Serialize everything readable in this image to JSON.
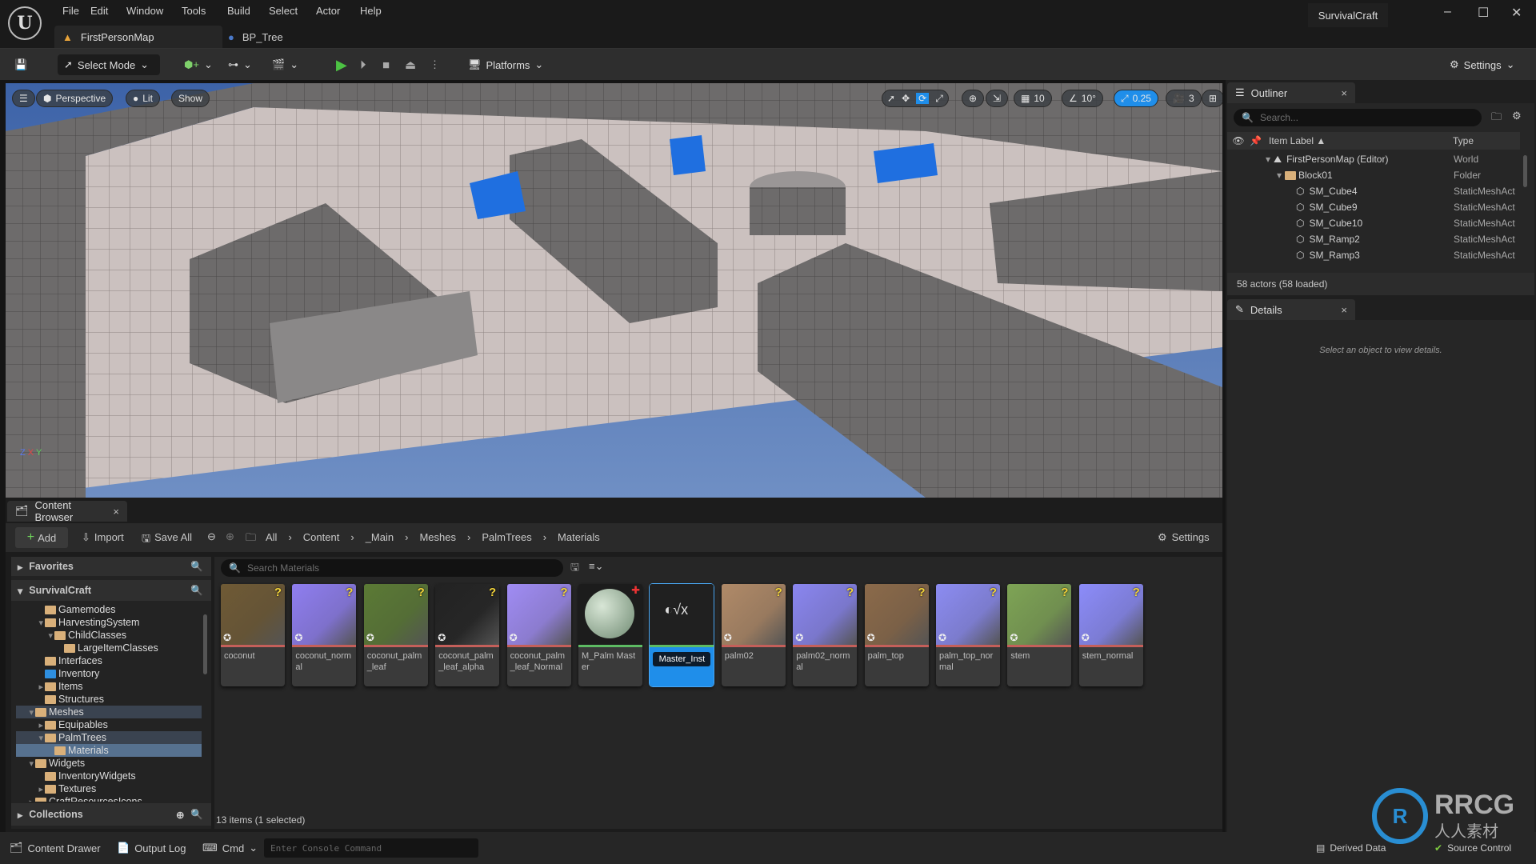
{
  "app": {
    "menu": [
      "File",
      "Edit",
      "Window",
      "Tools",
      "Build",
      "Select",
      "Actor",
      "Help"
    ],
    "tabs": [
      "FirstPersonMap",
      "BP_Tree"
    ],
    "project": "SurvivalCraft"
  },
  "toolbar": {
    "select_mode": "Select Mode",
    "platforms": "Platforms",
    "settings": "Settings"
  },
  "viewport": {
    "perspective": "Perspective",
    "lit": "Lit",
    "show": "Show",
    "grid_snap": "10",
    "rot_snap": "10°",
    "scale_snap": "0.25",
    "cam_speed": "3",
    "axis_labels": [
      "Z",
      "X",
      "Y"
    ]
  },
  "outliner": {
    "title": "Outliner",
    "search_placeholder": "Search...",
    "col_label": "Item Label",
    "col_type": "Type",
    "rows": [
      {
        "label": "FirstPersonMap (Editor)",
        "type": "World",
        "indent": 0,
        "icon": "world-icon"
      },
      {
        "label": "Block01",
        "type": "Folder",
        "indent": 1,
        "icon": "folder-icon"
      },
      {
        "label": "SM_Cube4",
        "type": "StaticMeshAct",
        "indent": 2,
        "icon": "static-mesh-icon"
      },
      {
        "label": "SM_Cube9",
        "type": "StaticMeshAct",
        "indent": 2,
        "icon": "static-mesh-icon"
      },
      {
        "label": "SM_Cube10",
        "type": "StaticMeshAct",
        "indent": 2,
        "icon": "static-mesh-icon"
      },
      {
        "label": "SM_Ramp2",
        "type": "StaticMeshAct",
        "indent": 2,
        "icon": "static-mesh-icon"
      },
      {
        "label": "SM_Ramp3",
        "type": "StaticMeshAct",
        "indent": 2,
        "icon": "static-mesh-icon"
      }
    ],
    "status": "58 actors (58 loaded)"
  },
  "details": {
    "title": "Details",
    "empty": "Select an object to view details."
  },
  "content_browser": {
    "title": "Content Browser",
    "add": "Add",
    "import": "Import",
    "save_all": "Save All",
    "settings": "Settings",
    "breadcrumb": [
      "All",
      "Content",
      "_Main",
      "Meshes",
      "PalmTrees",
      "Materials"
    ],
    "favorites": "Favorites",
    "project": "SurvivalCraft",
    "collections": "Collections",
    "search_placeholder": "Search Materials",
    "tree": [
      {
        "label": "Gamemodes",
        "indent": 2,
        "exp": ""
      },
      {
        "label": "HarvestingSystem",
        "indent": 2,
        "exp": "open"
      },
      {
        "label": "ChildClasses",
        "indent": 3,
        "exp": "open"
      },
      {
        "label": "LargeItemClasses",
        "indent": 4,
        "exp": ""
      },
      {
        "label": "Interfaces",
        "indent": 2,
        "exp": ""
      },
      {
        "label": "Inventory",
        "indent": 2,
        "exp": "",
        "blue": true
      },
      {
        "label": "Items",
        "indent": 2,
        "exp": "closed"
      },
      {
        "label": "Structures",
        "indent": 2,
        "exp": ""
      },
      {
        "label": "Meshes",
        "indent": 1,
        "exp": "open",
        "hl": true
      },
      {
        "label": "Equipables",
        "indent": 2,
        "exp": "closed"
      },
      {
        "label": "PalmTrees",
        "indent": 2,
        "exp": "open",
        "hl": true
      },
      {
        "label": "Materials",
        "indent": 3,
        "exp": "",
        "sel": true
      },
      {
        "label": "Widgets",
        "indent": 1,
        "exp": "open"
      },
      {
        "label": "InventoryWidgets",
        "indent": 2,
        "exp": ""
      },
      {
        "label": "Textures",
        "indent": 2,
        "exp": "closed"
      },
      {
        "label": "CraftResourcesIcons",
        "indent": 1,
        "exp": "closed"
      }
    ],
    "items": [
      {
        "label": "coconut",
        "thumb": "#6f5a35"
      },
      {
        "label": "coconut_normal",
        "thumb": "#8f7ef0"
      },
      {
        "label": "coconut_palm_leaf",
        "thumb": "#5b7a35"
      },
      {
        "label": "coconut_palm_leaf_alpha",
        "thumb": "#222222"
      },
      {
        "label": "coconut_palm_leaf_Normal",
        "thumb": "#a08cf4"
      },
      {
        "label": "M_Palm Master",
        "thumb": "#1c1c1c",
        "kind": "material"
      },
      {
        "label": "Master_Inst",
        "thumb": "#202020",
        "kind": "instance",
        "selected": true
      },
      {
        "label": "palm02",
        "thumb": "#b08a68"
      },
      {
        "label": "palm02_normal",
        "thumb": "#8a86f0"
      },
      {
        "label": "palm_top",
        "thumb": "#8b6a4a"
      },
      {
        "label": "palm_top_normal",
        "thumb": "#8c8cf2"
      },
      {
        "label": "stem",
        "thumb": "#7ea455"
      },
      {
        "label": "stem_normal",
        "thumb": "#8c8cfa"
      }
    ],
    "status": "13 items (1 selected)"
  },
  "bottom": {
    "content_drawer": "Content Drawer",
    "output_log": "Output Log",
    "cmd": "Cmd",
    "console_placeholder": "Enter Console Command",
    "derived_data": "Derived Data",
    "source_control": "Source Control"
  },
  "watermark": {
    "text": "RRCG",
    "sub": "人人素材"
  },
  "colors": {
    "accent": "#1f8eea",
    "play": "#4cc243",
    "folder": "#d9b07a"
  }
}
